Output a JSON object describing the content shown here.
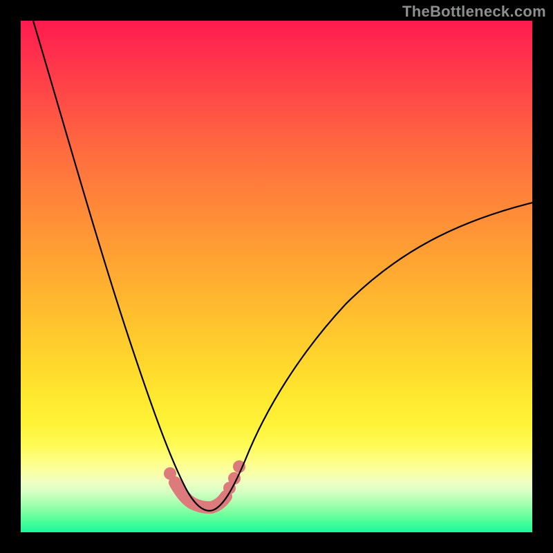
{
  "watermark": "TheBottleneck.com",
  "chart_data": {
    "type": "line",
    "title": "",
    "xlabel": "",
    "ylabel": "",
    "xlim": [
      0,
      100
    ],
    "ylim": [
      0,
      100
    ],
    "grid": false,
    "legend": false,
    "series": [
      {
        "name": "bottleneck-curve",
        "x": [
          2,
          5,
          8,
          11,
          14,
          17,
          20,
          23,
          26,
          28,
          29.5,
          31,
          32.5,
          34,
          35.5,
          37,
          39,
          41.5,
          45,
          50,
          56,
          63,
          71,
          80,
          90,
          100
        ],
        "y": [
          100,
          88,
          76,
          65,
          54,
          44,
          34,
          25,
          17,
          12,
          9.5,
          7.5,
          6,
          5.2,
          5,
          5.2,
          6,
          8,
          12,
          18,
          25,
          33,
          41,
          49,
          57,
          64
        ],
        "note": "y interpreted as percentage height from bottom (0) to top (100); V-shaped curve with minimum ≈5 near x≈35"
      }
    ],
    "highlight": {
      "name": "optimal-zone",
      "x_range": [
        29,
        41
      ],
      "points": [
        {
          "x": 29,
          "y": 10
        },
        {
          "x": 31,
          "y": 7
        },
        {
          "x": 33,
          "y": 5.5
        },
        {
          "x": 35,
          "y": 5
        },
        {
          "x": 37,
          "y": 5.5
        },
        {
          "x": 39,
          "y": 7
        },
        {
          "x": 40.5,
          "y": 9
        },
        {
          "x": 41.5,
          "y": 11
        }
      ]
    },
    "background": "vertical-gradient-rainbow",
    "description": "V-shaped black curve on rainbow (red→orange→yellow→green) gradient; pink rounded segment marks the trough."
  }
}
